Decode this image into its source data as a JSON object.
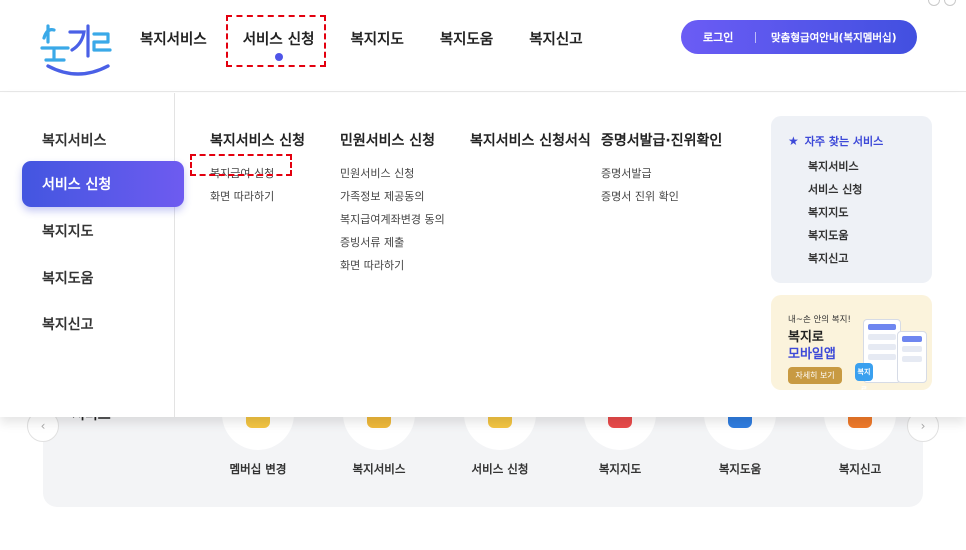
{
  "header": {
    "gnb": [
      "복지서비스",
      "서비스 신청",
      "복지지도",
      "복지도움",
      "복지신고"
    ],
    "login": "로그인",
    "guide": "맞춤형급여안내(복지멤버십)"
  },
  "sidebar": {
    "items": [
      "복지서비스",
      "서비스 신청",
      "복지지도",
      "복지도움",
      "복지신고"
    ]
  },
  "columns": [
    {
      "title": "복지서비스 신청",
      "links": [
        "복지급여 신청",
        "화면 따라하기"
      ]
    },
    {
      "title": "민원서비스 신청",
      "links": [
        "민원서비스 신청",
        "가족정보 제공동의",
        "복지급여계좌변경 동의",
        "증빙서류 제출",
        "화면 따라하기"
      ]
    },
    {
      "title": "복지서비스 신청서식",
      "links": []
    },
    {
      "title": "증명서발급·진위확인",
      "links": [
        "증명서발급",
        "증명서 진위 확인"
      ]
    }
  ],
  "favorites": {
    "title": "자주 찾는 서비스",
    "items": [
      "복지서비스",
      "서비스 신청",
      "복지지도",
      "복지도움",
      "복지신고"
    ]
  },
  "app_banner": {
    "small": "내~손 안의 복지!",
    "line1": "복지로",
    "line2": "모바일앱",
    "button": "자세히 보기",
    "icon": "복지로"
  },
  "quick": {
    "title": "서비스",
    "items": [
      {
        "label": "멤버십 변경",
        "color": "#f4c542"
      },
      {
        "label": "복지서비스",
        "color": "#f0b93a"
      },
      {
        "label": "서비스 신청",
        "color": "#f4c542"
      },
      {
        "label": "복지지도",
        "color": "#ea4b4b"
      },
      {
        "label": "복지도움",
        "color": "#2f7de0"
      },
      {
        "label": "복지신고",
        "color": "#f07a2a"
      }
    ]
  },
  "colors": {
    "accent": "#4f55e8",
    "highlight": "#e3000f"
  }
}
